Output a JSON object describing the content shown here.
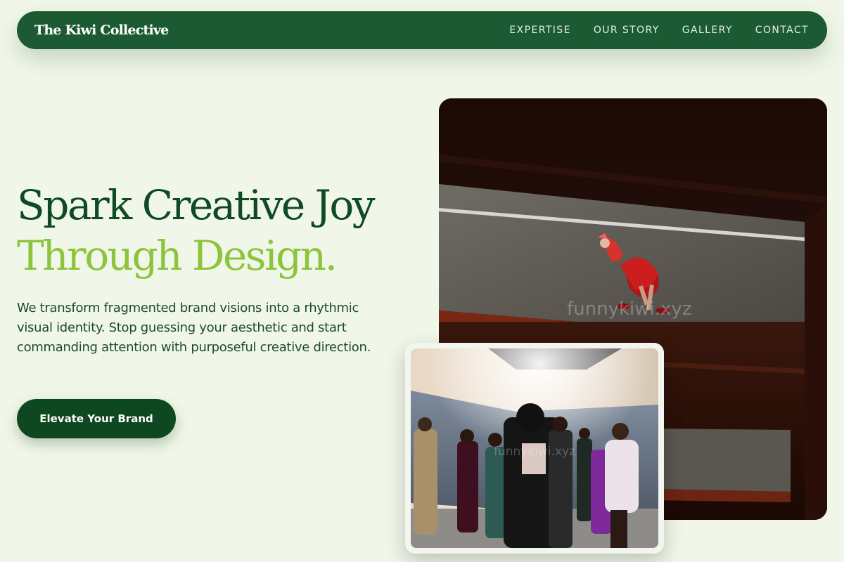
{
  "nav": {
    "brand": "The Kiwi Collective",
    "links": [
      "EXPERTISE",
      "OUR STORY",
      "GALLERY",
      "CONTACT"
    ]
  },
  "hero": {
    "headline_line1": "Spark Creative Joy",
    "headline_line2": "Through Design.",
    "description": "We transform fragmented brand visions into a rhythmic visual identity. Stop guessing your aesthetic and start commanding attention with purposeful creative direction.",
    "cta_label": "Elevate Your Brand"
  },
  "images": {
    "main_watermark": "funnykiwi.xyz",
    "secondary_watermark": "funnykiwi.xyz"
  },
  "colors": {
    "background": "#f0f7e8",
    "nav_green": "#1b5a32",
    "headline_dark": "#0f4a25",
    "headline_accent": "#8dc43e",
    "cta_green": "#0e4820"
  }
}
